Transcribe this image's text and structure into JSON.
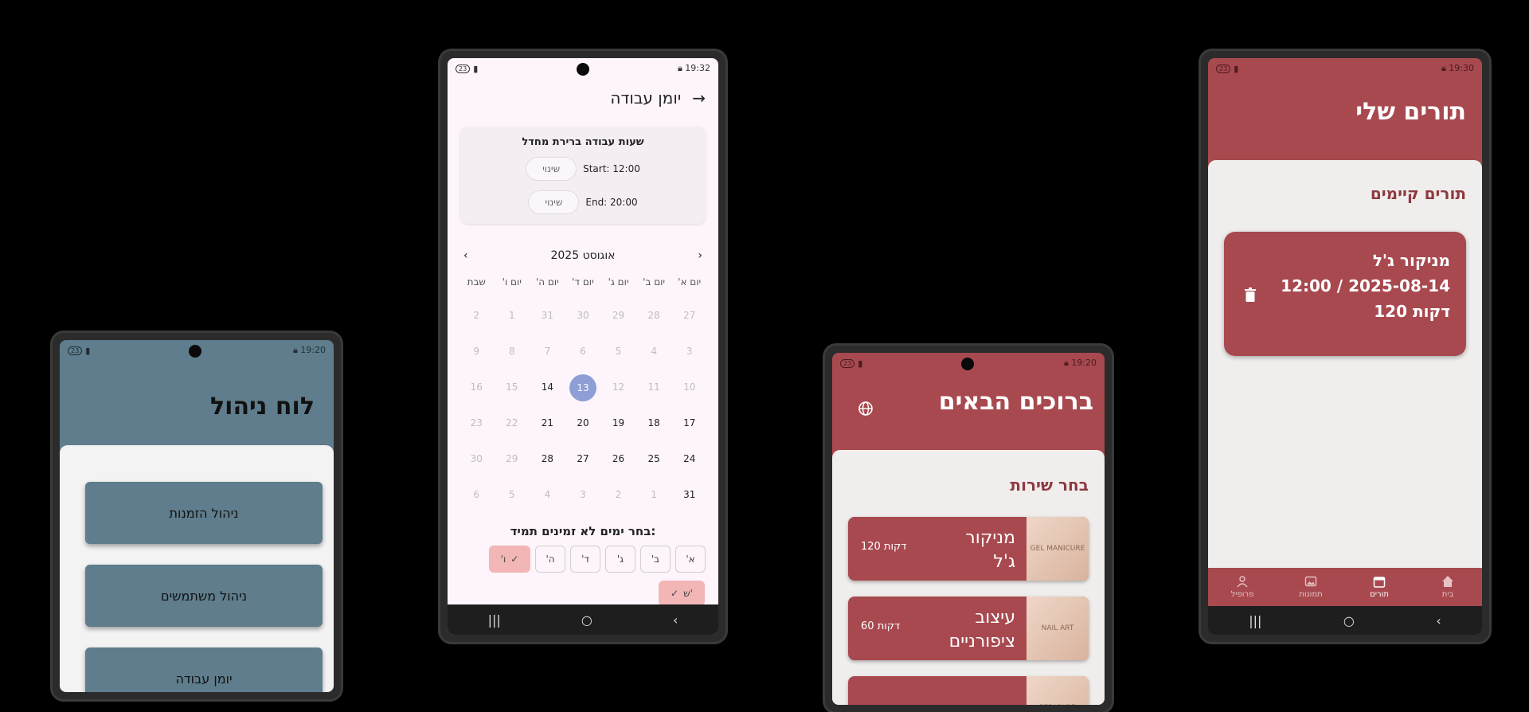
{
  "admin": {
    "status_time": "19:20",
    "status_badge": "23",
    "title": "לוח ניהול",
    "buttons": [
      "ניהול הזמנות",
      "ניהול משתמשים",
      "יומן עבודה"
    ]
  },
  "schedule": {
    "status_time": "19:32",
    "status_badge": "23",
    "title": "יומן עבודה",
    "default_hours_title": "שעות עבודה ברירת מחדל",
    "start_label": "Start: 12:00",
    "end_label": "End: 20:00",
    "change_label": "שינוי",
    "month": "אוגוסט 2025",
    "weekdays": [
      "יום א'",
      "יום ב'",
      "יום ג'",
      "יום ד'",
      "יום ה'",
      "יום ו'",
      "שבת"
    ],
    "weeks": [
      [
        {
          "d": "27",
          "s": "muted"
        },
        {
          "d": "28",
          "s": "muted"
        },
        {
          "d": "29",
          "s": "muted"
        },
        {
          "d": "30",
          "s": "muted"
        },
        {
          "d": "31",
          "s": "muted"
        },
        {
          "d": "1",
          "s": "muted"
        },
        {
          "d": "2",
          "s": "muted"
        }
      ],
      [
        {
          "d": "3",
          "s": "muted"
        },
        {
          "d": "4",
          "s": "muted"
        },
        {
          "d": "5",
          "s": "muted"
        },
        {
          "d": "6",
          "s": "muted"
        },
        {
          "d": "7",
          "s": "muted"
        },
        {
          "d": "8",
          "s": "muted"
        },
        {
          "d": "9",
          "s": "muted"
        }
      ],
      [
        {
          "d": "10",
          "s": "muted"
        },
        {
          "d": "11",
          "s": "muted"
        },
        {
          "d": "12",
          "s": "muted"
        },
        {
          "d": "13",
          "s": "sel"
        },
        {
          "d": "14",
          "s": "active"
        },
        {
          "d": "15",
          "s": "muted"
        },
        {
          "d": "16",
          "s": "muted"
        }
      ],
      [
        {
          "d": "17",
          "s": "active"
        },
        {
          "d": "18",
          "s": "active"
        },
        {
          "d": "19",
          "s": "active"
        },
        {
          "d": "20",
          "s": "active"
        },
        {
          "d": "21",
          "s": "active"
        },
        {
          "d": "22",
          "s": "muted"
        },
        {
          "d": "23",
          "s": "muted"
        }
      ],
      [
        {
          "d": "24",
          "s": "active"
        },
        {
          "d": "25",
          "s": "active"
        },
        {
          "d": "26",
          "s": "active"
        },
        {
          "d": "27",
          "s": "active"
        },
        {
          "d": "28",
          "s": "active"
        },
        {
          "d": "29",
          "s": "muted"
        },
        {
          "d": "30",
          "s": "muted"
        }
      ],
      [
        {
          "d": "31",
          "s": "active"
        },
        {
          "d": "1",
          "s": "muted"
        },
        {
          "d": "2",
          "s": "muted"
        },
        {
          "d": "3",
          "s": "muted"
        },
        {
          "d": "4",
          "s": "muted"
        },
        {
          "d": "5",
          "s": "muted"
        },
        {
          "d": "6",
          "s": "muted"
        }
      ]
    ],
    "prompt": "בחר ימים לא זמינים תמיד:",
    "day_chips": [
      {
        "label": "א'",
        "on": false
      },
      {
        "label": "ב'",
        "on": false
      },
      {
        "label": "ג'",
        "on": false
      },
      {
        "label": "ד'",
        "on": false
      },
      {
        "label": "ה'",
        "on": false
      },
      {
        "label": "ו'",
        "on": true
      }
    ],
    "extra_chip": "ש'"
  },
  "welcome": {
    "status_time": "19:20",
    "status_badge": "23",
    "title": "ברוכים הבאים",
    "subtitle": "בחר שירות",
    "services": [
      {
        "name": "מניקור\nג'ל",
        "duration": "120 דקות",
        "img": "GEL MANICURE"
      },
      {
        "name": "עיצוב\nציפורניים",
        "duration": "60 דקות",
        "img": "NAIL ART"
      },
      {
        "name": "",
        "duration": "",
        "img": "PEDICURE"
      }
    ]
  },
  "my_appointments": {
    "status_time": "19:30",
    "status_badge": "23",
    "title": "תורים שלי",
    "subtitle": "תורים קיימים",
    "appointment": {
      "service": "מניקור ג'ל",
      "datetime": "12:00 / 2025-08-14",
      "duration": "120 דקות"
    },
    "tabs": [
      {
        "label": "בית",
        "icon": "home-icon",
        "on": false
      },
      {
        "label": "תורים",
        "icon": "calendar-icon",
        "on": true
      },
      {
        "label": "תמונות",
        "icon": "image-icon",
        "on": false
      },
      {
        "label": "פרופיל",
        "icon": "person-icon",
        "on": false
      }
    ]
  },
  "colors": {
    "brand": "#a84950",
    "admin": "#5f7d8c",
    "selected_day": "#8d9fd6",
    "chip_on": "#f2b6b6"
  }
}
